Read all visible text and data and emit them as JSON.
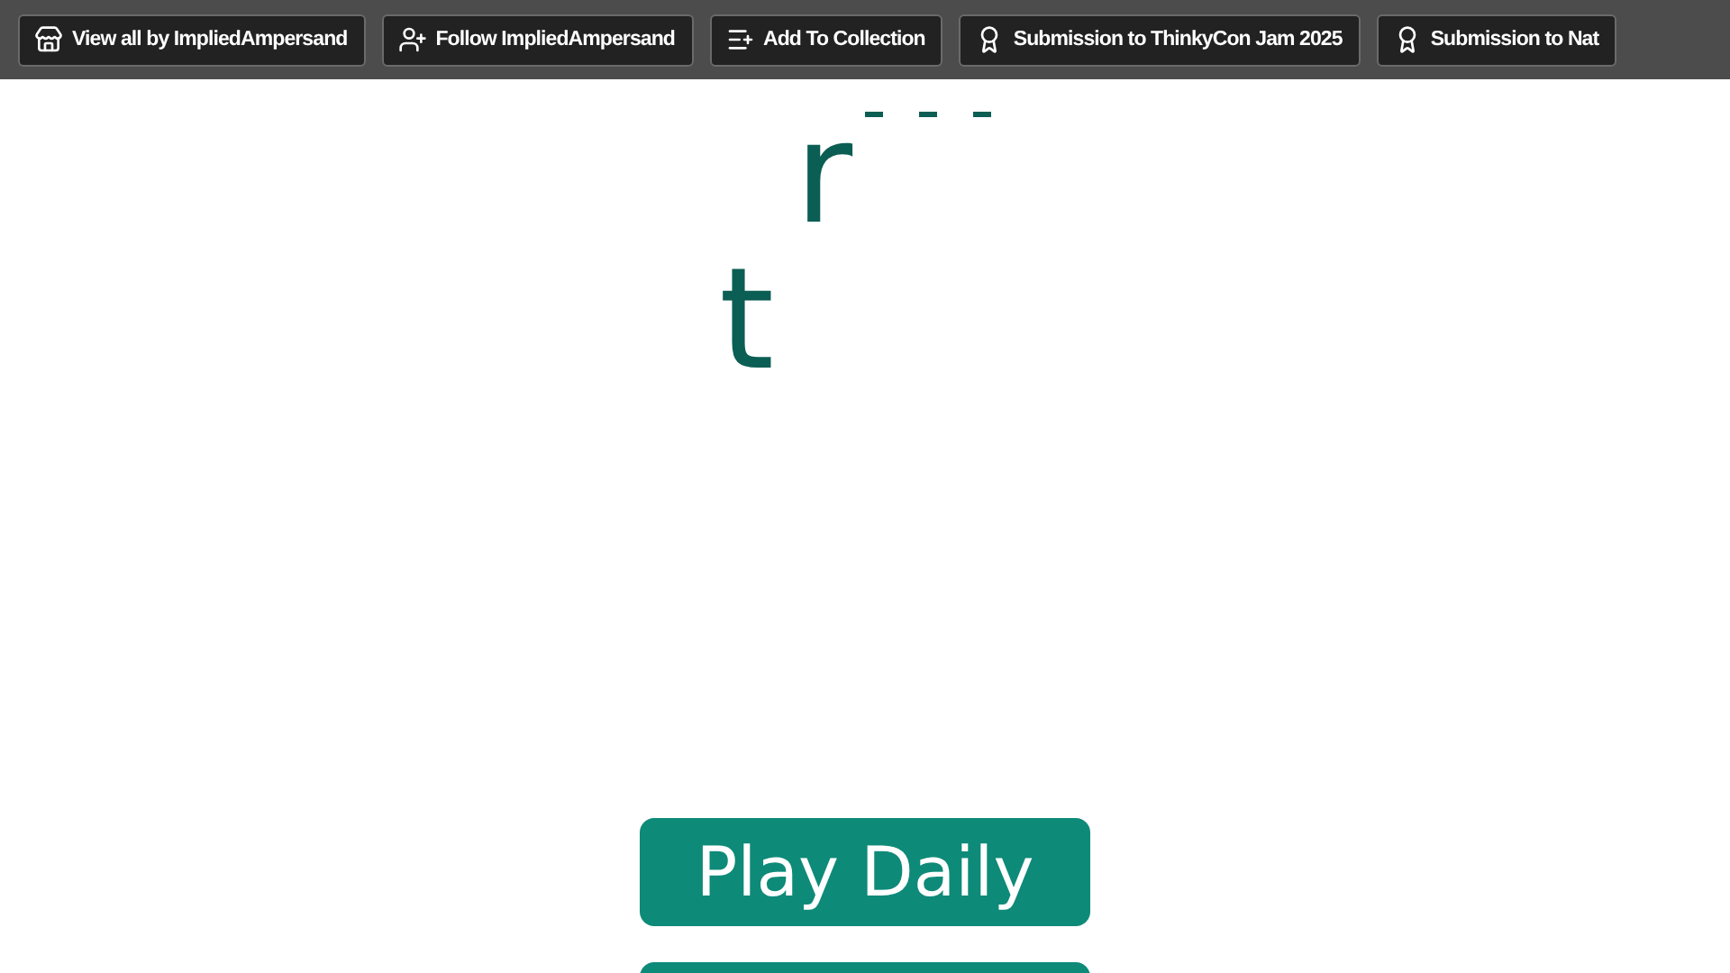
{
  "top_bar": {
    "buttons": [
      {
        "kind": "store",
        "label": "View all by ImpliedAmpersand"
      },
      {
        "kind": "follow",
        "label": "Follow ImpliedAmpersand"
      },
      {
        "kind": "collection",
        "label": "Add To Collection"
      },
      {
        "kind": "award",
        "label": "Submission to ThinkyCon Jam 2025"
      },
      {
        "kind": "award",
        "label": "Submission to Nat"
      }
    ]
  },
  "board": {
    "letters": [
      "r",
      "t"
    ]
  },
  "menu": {
    "buttons": [
      "Play Daily"
    ]
  }
}
